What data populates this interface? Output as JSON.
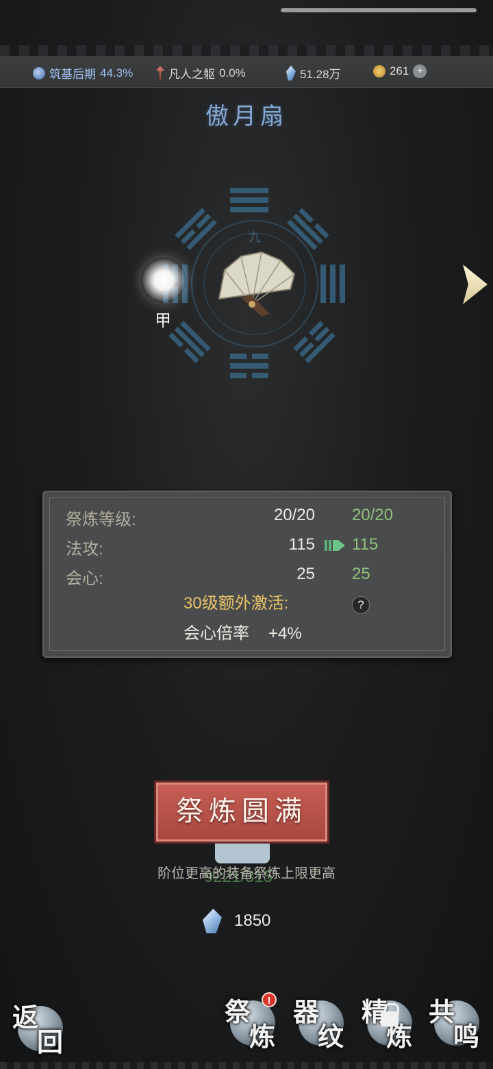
{
  "resources": {
    "realm_label": "筑基后期",
    "realm_pct": "44.3%",
    "body_label": "凡人之躯",
    "body_pct": "0.0%",
    "crystal": "51.28万",
    "coin": "261"
  },
  "item_title": "傲月扇",
  "spirit_grade": "甲",
  "bagua_center_glyph": "九",
  "stats": {
    "rows": [
      {
        "label": "祭炼等级:",
        "current": "20/20",
        "next": "20/20"
      },
      {
        "label": "法攻:",
        "current": "115",
        "next": "115"
      },
      {
        "label": "会心:",
        "current": "25",
        "next": "25"
      }
    ],
    "bonus_title": "30级额外激活:",
    "help": "?",
    "bonus_name": "会心倍率",
    "bonus_value": "+4%"
  },
  "refine_button": "祭炼圆满",
  "ghost_number": "9221/315",
  "hint": "阶位更高的装备祭炼上限更高",
  "cost": "1850",
  "nav": {
    "back": [
      "返",
      "回"
    ],
    "refine": [
      "祭",
      "炼"
    ],
    "pattern": [
      "器",
      "纹"
    ],
    "smelt": [
      "精",
      "炼"
    ],
    "resonance": [
      "共",
      "鸣"
    ],
    "badge": "!"
  },
  "colors": {
    "title": "#86a9d3",
    "next_value": "#8fc27c",
    "bonus_title": "#e6c366",
    "button": "#b34f46"
  }
}
